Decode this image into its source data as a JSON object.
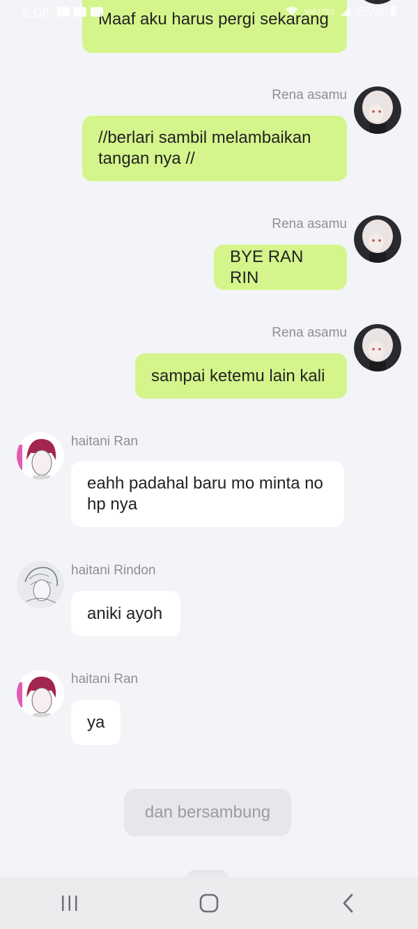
{
  "status_bar": {
    "time": "6:08",
    "network": "Vo0 LTE2",
    "battery": "55%"
  },
  "messages": [
    {
      "side": "right",
      "sender": "",
      "text": "Maaf aku harus pergi sekarang"
    },
    {
      "side": "right",
      "sender": "Rena asamu",
      "text": "//berlari sambil melambaikan tangan nya //"
    },
    {
      "side": "right",
      "sender": "Rena asamu",
      "text": "BYE RAN RIN"
    },
    {
      "side": "right",
      "sender": "Rena asamu",
      "text": "sampai ketemu lain kali"
    },
    {
      "side": "left",
      "sender": "haitani Ran",
      "text": "eahh padahal baru mo minta no hp nya"
    },
    {
      "side": "left",
      "sender": "haitani Rindon",
      "text": "aniki ayoh"
    },
    {
      "side": "left",
      "sender": "haitani Ran",
      "text": "ya"
    }
  ],
  "end_label": "dan bersambung",
  "nav": {
    "recent": "recent-apps",
    "home": "home",
    "back": "back"
  },
  "colors": {
    "outgoing_bubble": "#d4f58b",
    "incoming_bubble": "#ffffff",
    "background": "#f3f4f8"
  }
}
